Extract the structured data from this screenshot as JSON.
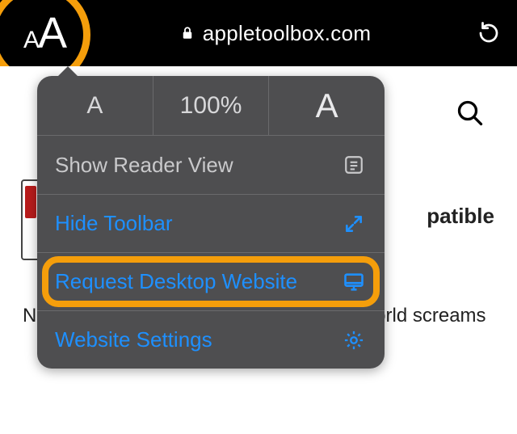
{
  "addressbar": {
    "domain": "appletoolbox.com"
  },
  "zoom": {
    "level": "100%"
  },
  "menu": {
    "reader_label": "Show Reader View",
    "hide_toolbar_label": "Hide Toolbar",
    "request_desktop_label": "Request Desktop Website",
    "website_settings_label": "Website Settings"
  },
  "background_page": {
    "heading_fragment": "patible",
    "body_text": "N                                                                                             g services o                                                                                             ple is p                                                                                              etflix. But as the world screams"
  },
  "colors": {
    "accent_orange": "#f59e0b",
    "link_blue": "#1e90ff",
    "menu_bg": "#4e4e50"
  }
}
